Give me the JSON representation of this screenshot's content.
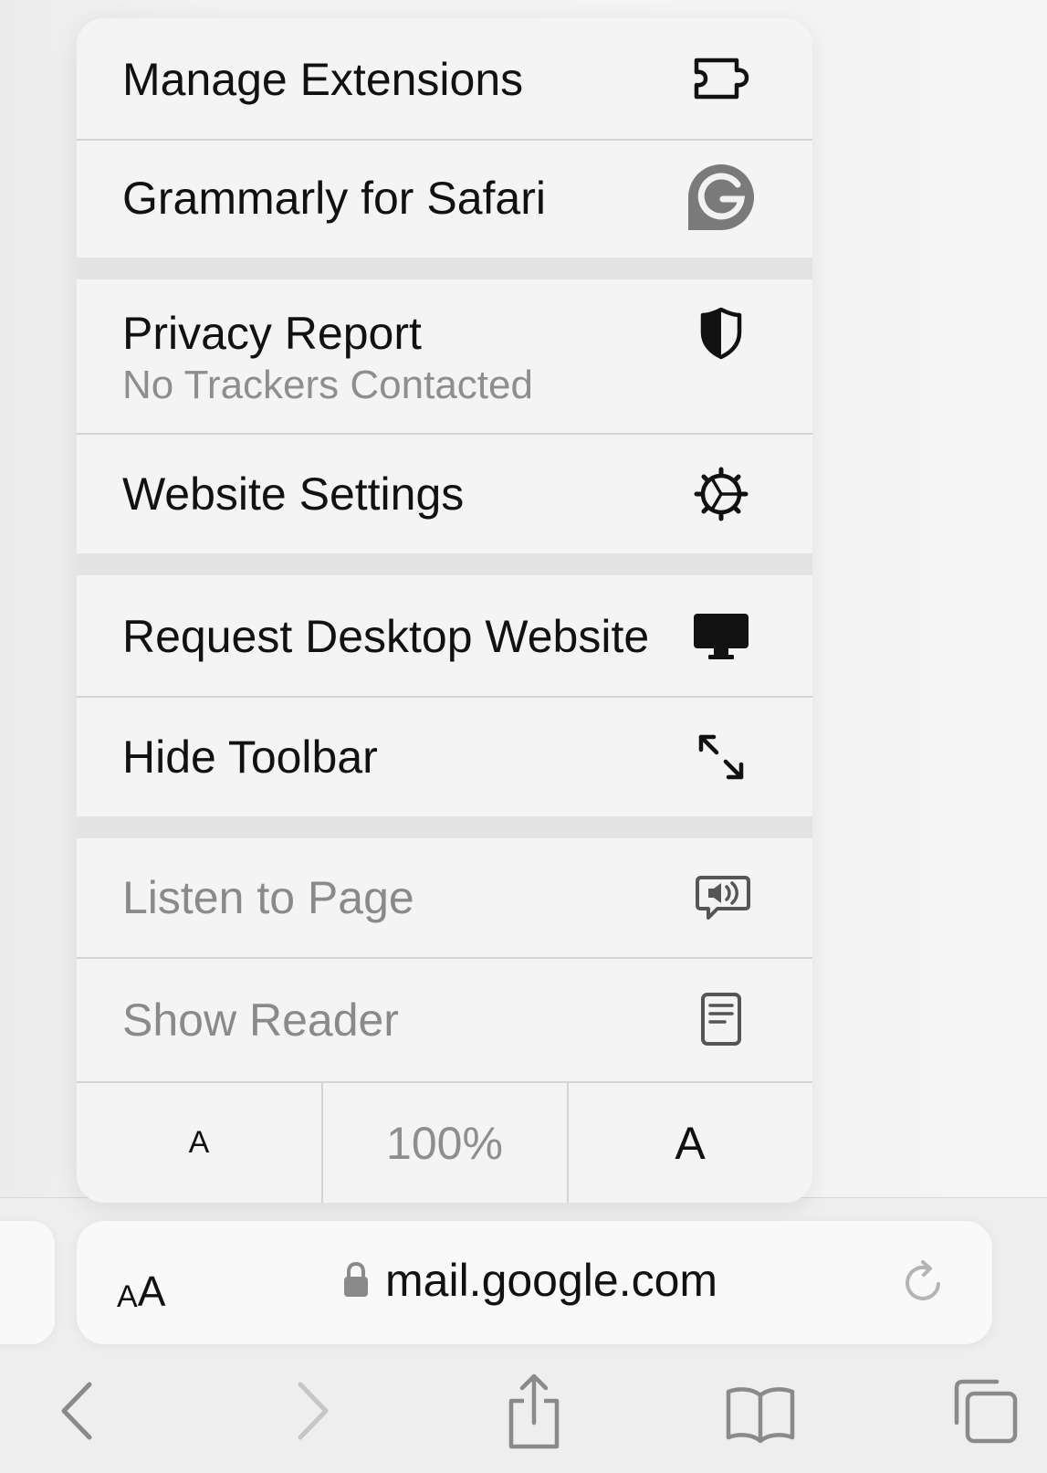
{
  "menu": {
    "manage_extensions": {
      "label": "Manage Extensions",
      "icon": "puzzle-piece-icon"
    },
    "grammarly": {
      "label": "Grammarly for Safari",
      "icon": "grammarly-logo-icon"
    },
    "privacy_report": {
      "label": "Privacy Report",
      "subtitle": "No Trackers Contacted",
      "icon": "shield-icon"
    },
    "website_settings": {
      "label": "Website Settings",
      "icon": "gear-icon"
    },
    "request_desktop": {
      "label": "Request Desktop Website",
      "icon": "desktop-icon"
    },
    "hide_toolbar": {
      "label": "Hide Toolbar",
      "icon": "expand-arrows-icon"
    },
    "listen_to_page": {
      "label": "Listen to Page",
      "icon": "speaker-bubble-icon",
      "enabled": false
    },
    "show_reader": {
      "label": "Show Reader",
      "icon": "reader-document-icon",
      "enabled": false
    },
    "zoom": {
      "decrease": "A",
      "level": "100%",
      "increase": "A"
    }
  },
  "address_bar": {
    "aa_small": "A",
    "aa_large": "A",
    "url": "mail.google.com",
    "secure": true
  },
  "toolbar": {
    "buttons": [
      "back-icon",
      "forward-icon",
      "share-icon",
      "bookmarks-icon",
      "tabs-icon"
    ]
  },
  "colors": {
    "menu_bg": "#f4f4f4",
    "separator": "#e3e3e3",
    "text_primary": "#111111",
    "text_disabled": "#8a8a8a"
  }
}
